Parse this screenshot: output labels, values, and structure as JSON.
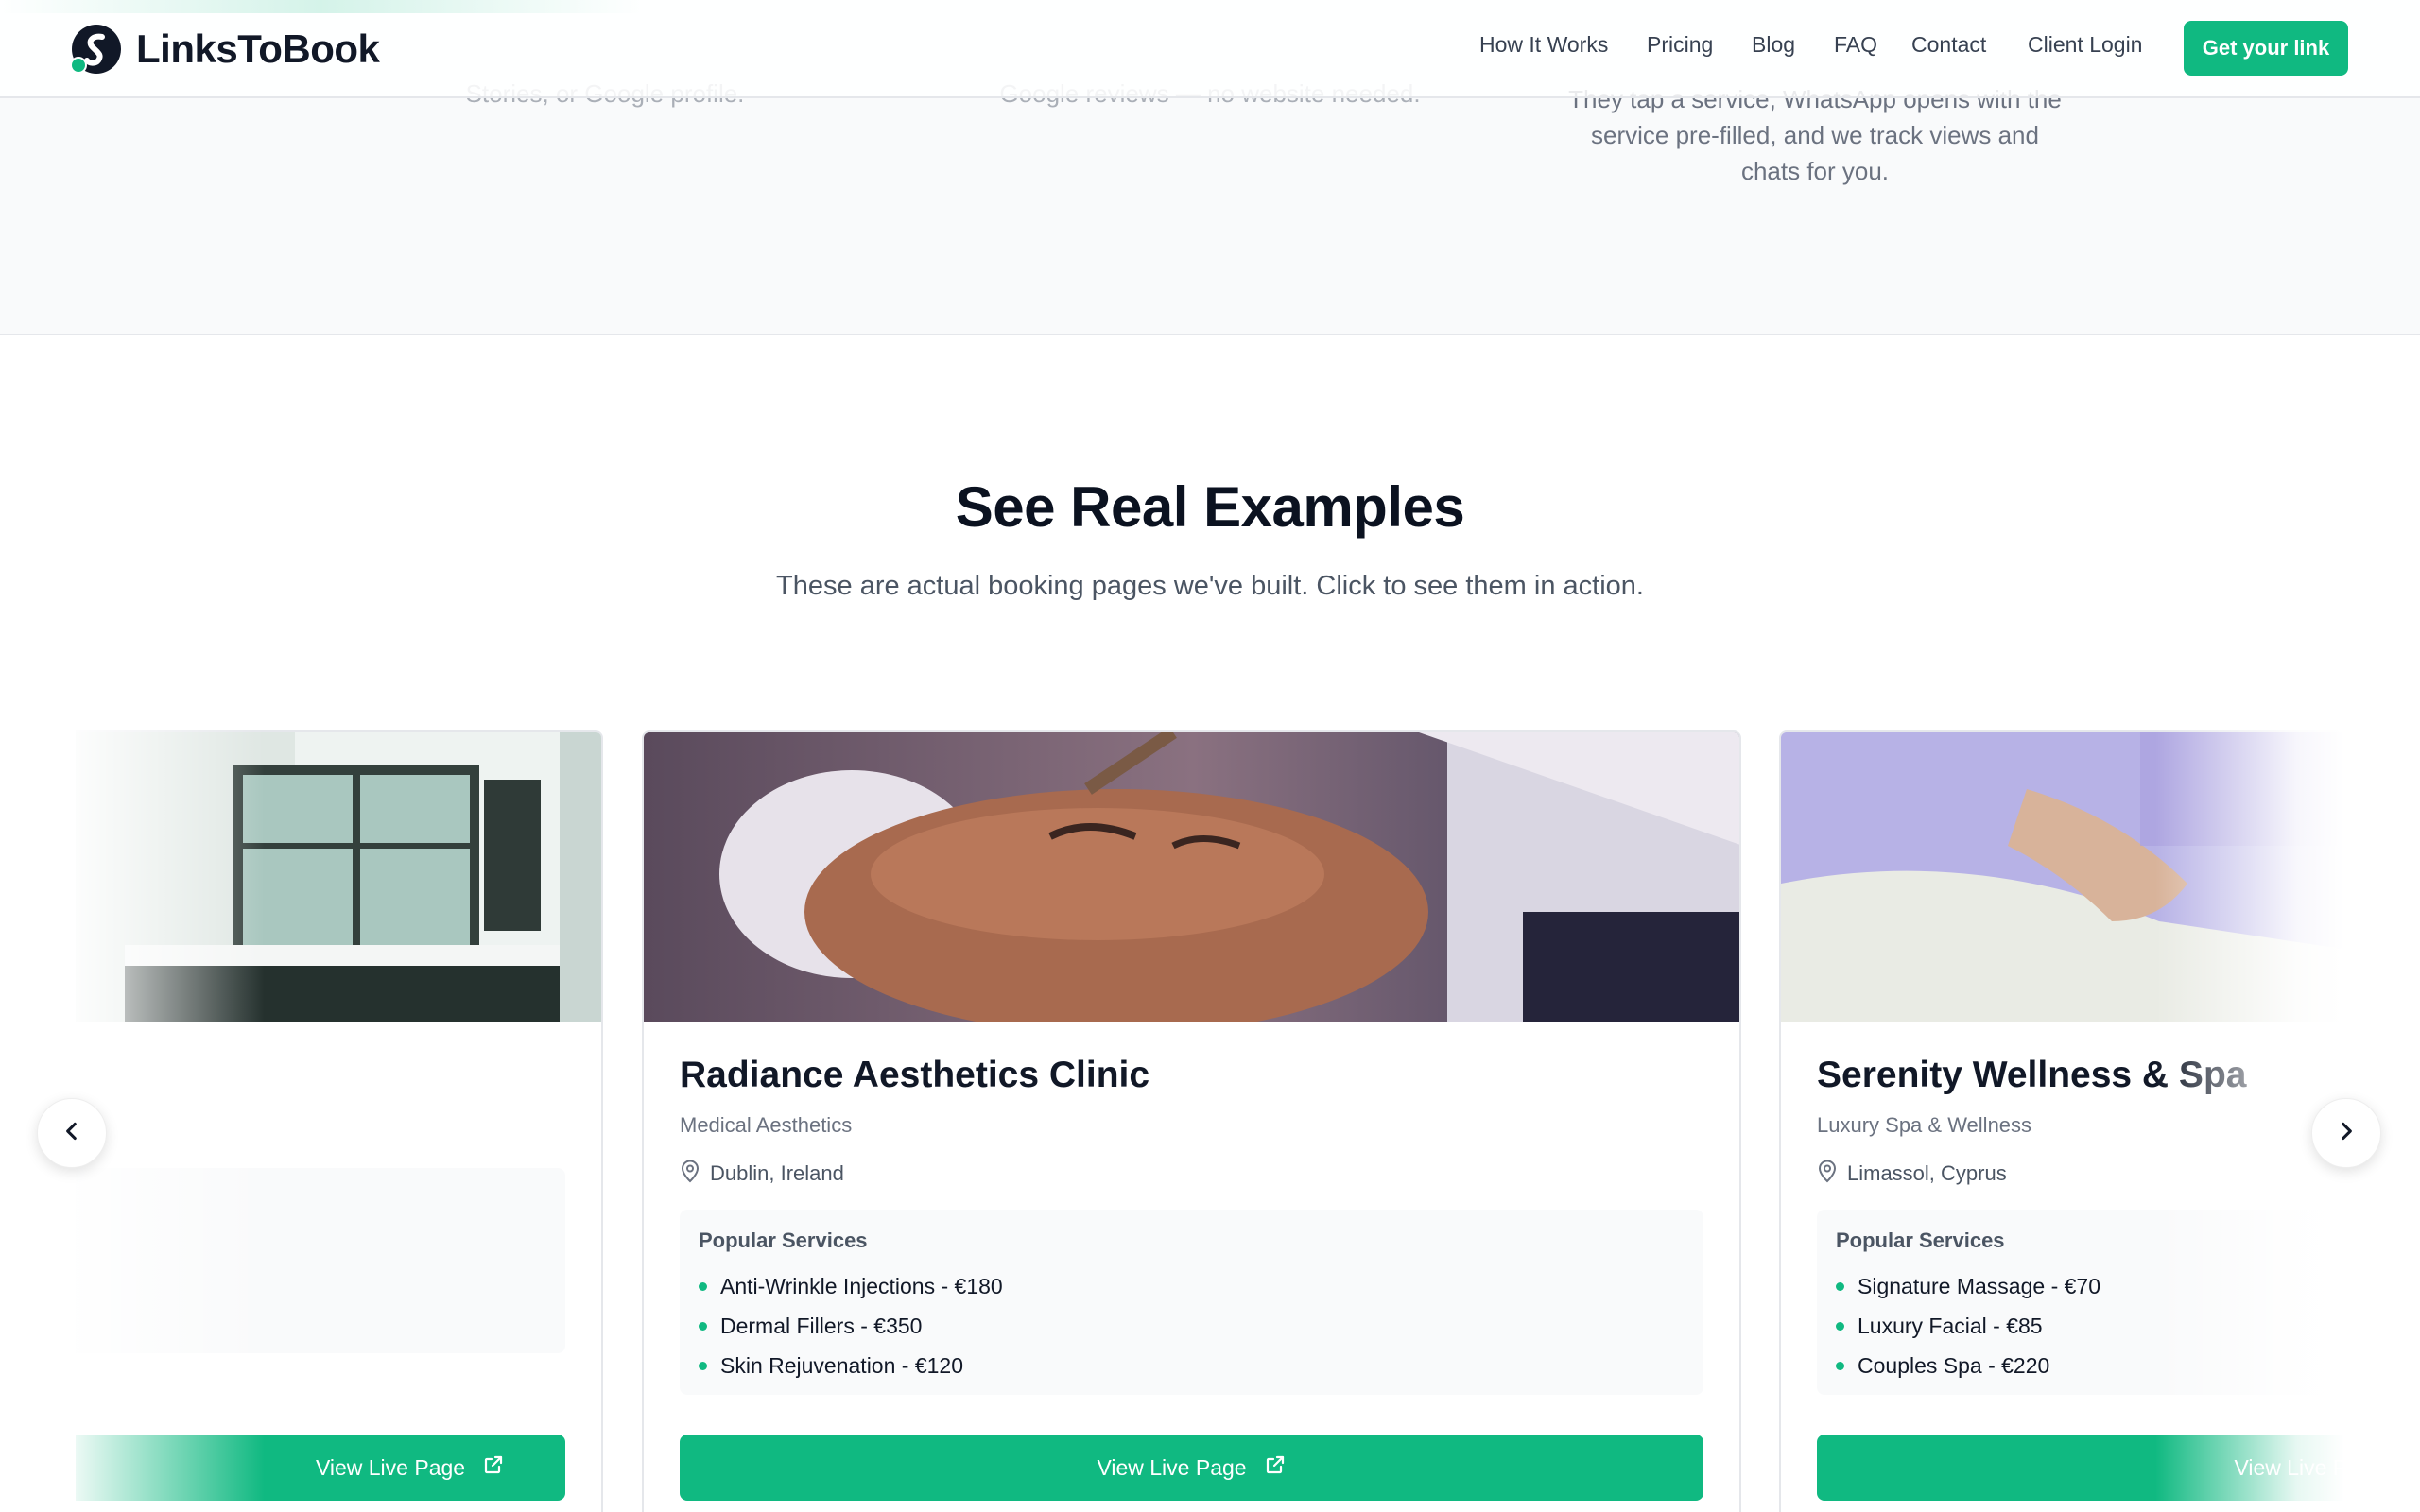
{
  "header": {
    "brand": "LinksToBook",
    "nav": [
      "How It Works",
      "Pricing",
      "Blog",
      "FAQ",
      "Contact",
      "Client Login"
    ],
    "cta": "Get your link"
  },
  "prev_section": {
    "col1_line": "Stories, or Google profile.",
    "col2_line": "Google reviews — no website needed.",
    "col3_lines": [
      "They tap a service, WhatsApp opens with the",
      "service pre-filled, and we track views and",
      "chats for you."
    ]
  },
  "examples": {
    "title": "See Real Examples",
    "subtitle": "These are actual booking pages we've built. Click to see them in action.",
    "cards": [
      {
        "title": "",
        "category": "",
        "location": "",
        "services_title": "",
        "services": [],
        "button": "View Live Page"
      },
      {
        "title": "Radiance Aesthetics Clinic",
        "category": "Medical Aesthetics",
        "location": "Dublin, Ireland",
        "services_title": "Popular Services",
        "services": [
          "Anti-Wrinkle Injections - €180",
          "Dermal Fillers - €350",
          "Skin Rejuvenation - €120"
        ],
        "button": "View Live Page"
      },
      {
        "title": "Serenity Wellness & Spa",
        "category": "Luxury Spa & Wellness",
        "location": "Limassol, Cyprus",
        "services_title": "Popular Services",
        "services": [
          "Signature Massage - €70",
          "Luxury Facial - €85",
          "Couples Spa - €220"
        ],
        "button": "View Live Page"
      }
    ]
  },
  "colors": {
    "accent": "#10b981",
    "text": "#111827",
    "muted": "#6b7280"
  },
  "icons": [
    "logo-icon",
    "map-pin-icon",
    "external-link-icon",
    "chevron-left-icon",
    "chevron-right-icon"
  ]
}
